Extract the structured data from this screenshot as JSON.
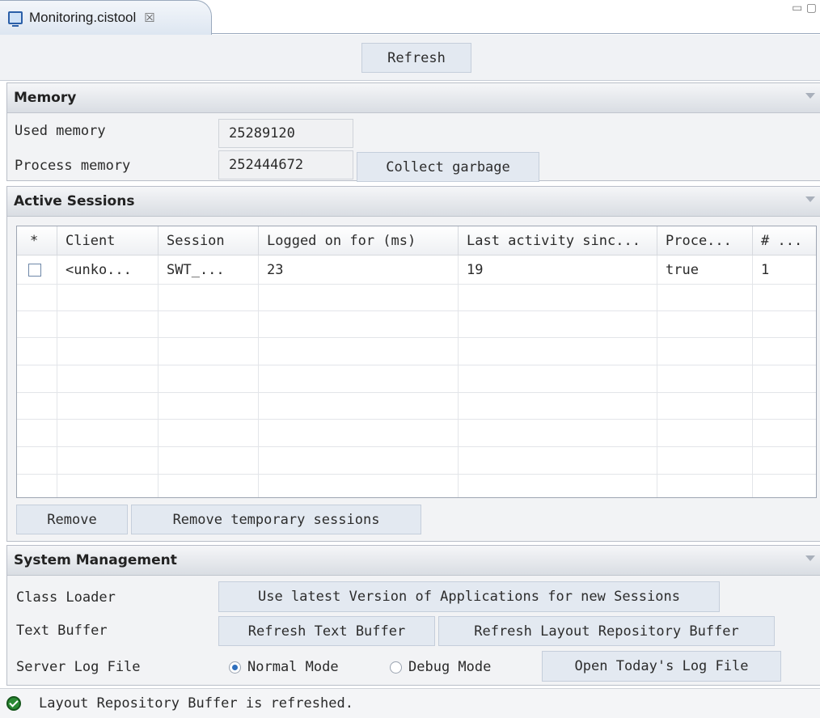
{
  "tab": {
    "title": "Monitoring.cistool",
    "close": "☒"
  },
  "window": {
    "controls": "▭ ▢"
  },
  "toolbar": {
    "refresh_label": "Refresh"
  },
  "memory": {
    "title": "Memory",
    "used_label": "Used memory",
    "used_value": "25289120",
    "process_label": "Process memory",
    "process_value": "252444672",
    "gc_label": "Collect garbage"
  },
  "sessions": {
    "title": "Active Sessions",
    "columns": [
      "*",
      "Client",
      "Session",
      "Logged on for (ms)",
      "Last activity sinc...",
      "Proce...",
      "# ..."
    ],
    "rows": [
      {
        "client": "<unko...",
        "session": "SWT_...",
        "logged_on": "23",
        "last_activity": "19",
        "processing": "true",
        "count": "1",
        "checked": false
      }
    ],
    "remove_label": "Remove",
    "remove_temp_label": "Remove temporary sessions"
  },
  "system": {
    "title": "System Management",
    "class_loader_label": "Class Loader",
    "class_loader_button": "Use latest Version of Applications for new Sessions",
    "text_buffer_label": "Text Buffer",
    "refresh_text_buffer": "Refresh Text Buffer",
    "refresh_layout_buffer": "Refresh Layout Repository Buffer",
    "server_log_label": "Server Log File",
    "normal_mode": "Normal Mode",
    "debug_mode": "Debug Mode",
    "selected_mode": "normal",
    "open_log_button": "Open Today's Log File"
  },
  "status": {
    "message": "Layout Repository Buffer is refreshed."
  },
  "colors": {
    "accent": "#2f6fbd",
    "ok_green": "#2b8a33"
  },
  "icons": {
    "tab": "view-icon",
    "status": "checkmark-icon"
  }
}
